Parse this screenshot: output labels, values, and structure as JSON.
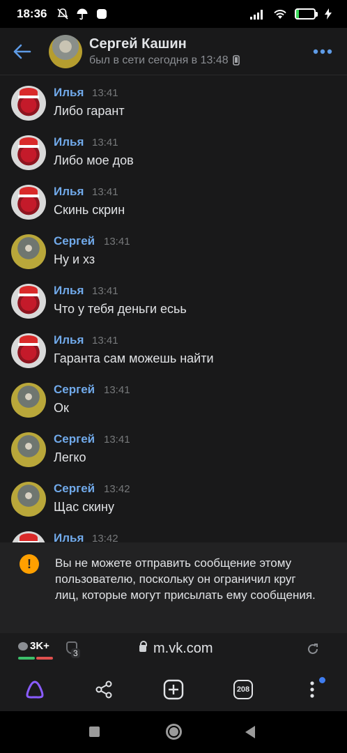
{
  "status_bar": {
    "time": "18:36",
    "battery_percent": "16",
    "battery_level": 0.16
  },
  "header": {
    "contact_name": "Сергей Кашин",
    "last_seen": "был в сети сегодня в 13:48"
  },
  "messages": [
    {
      "author": "Илья",
      "time": "13:41",
      "text": "Либо гарант",
      "avatar": "ilya"
    },
    {
      "author": "Илья",
      "time": "13:41",
      "text": "Либо мое дов",
      "avatar": "ilya"
    },
    {
      "author": "Илья",
      "time": "13:41",
      "text": "Скинь скрин",
      "avatar": "ilya"
    },
    {
      "author": "Сергей",
      "time": "13:41",
      "text": "Ну и хз",
      "avatar": "sergey"
    },
    {
      "author": "Илья",
      "time": "13:41",
      "text": "Что у тебя деньги есьь",
      "avatar": "ilya"
    },
    {
      "author": "Илья",
      "time": "13:41",
      "text": "Гаранта сам можешь найти",
      "avatar": "ilya"
    },
    {
      "author": "Сергей",
      "time": "13:41",
      "text": "Ок",
      "avatar": "sergey"
    },
    {
      "author": "Сергей",
      "time": "13:41",
      "text": "Легко",
      "avatar": "sergey"
    },
    {
      "author": "Сергей",
      "time": "13:42",
      "text": "Щас скину",
      "avatar": "sergey"
    },
    {
      "author": "Илья",
      "time": "13:42",
      "text": "",
      "avatar": "ilya"
    }
  ],
  "banner": {
    "text": "Вы не можете отправить сообщение этому пользователю, поскольку он ограничил круг лиц, которые могут присылать ему сообщения.",
    "icon": "warning-icon",
    "color": "#ffa000"
  },
  "browser": {
    "comments_count": "3K+",
    "tracker_count": "3",
    "domain": "m.vk.com",
    "tabs_count": "208"
  },
  "colors": {
    "accent": "#71aaeb",
    "background": "#19191a",
    "alice": "#7b52f5"
  }
}
